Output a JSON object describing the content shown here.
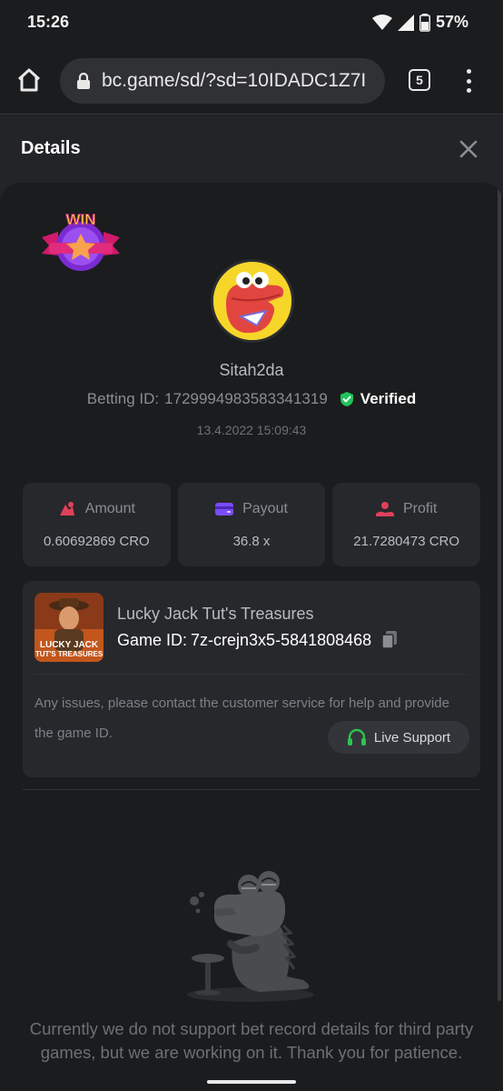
{
  "status": {
    "time": "15:26",
    "battery": "57%"
  },
  "browser": {
    "url": "bc.game/sd/?sd=10IDADC1Z7I",
    "tab_count": "5"
  },
  "details": {
    "title": "Details",
    "win_label": "WIN",
    "username": "Sitah2da",
    "betting_id_label": "Betting ID:",
    "betting_id": "1729994983583341319",
    "verified": "Verified",
    "timestamp": "13.4.2022 15:09:43",
    "stats": [
      {
        "label": "Amount",
        "value": "0.60692869 CRO",
        "color": "#e0405a"
      },
      {
        "label": "Payout",
        "value": "36.8 x",
        "color": "#7b4bff"
      },
      {
        "label": "Profit",
        "value": "21.7280473 CRO",
        "color": "#e0405a"
      }
    ],
    "game": {
      "name": "Lucky Jack Tut's Treasures",
      "id_label": "Game ID:",
      "id": "7z-crejn3x5-5841808468",
      "thumb_text_1": "LUCKY JACK",
      "thumb_text_2": "TUT'S TREASURES"
    },
    "issue_text": "Any issues, please contact the customer service for help and provide the game ID.",
    "live_support": "Live Support",
    "bottom_message": "Currently we do not support bet record details for third party games, but we are working on it. Thank you for patience."
  },
  "colors": {
    "verified_green": "#1fc35b",
    "support_green": "#2ec24e",
    "background": "#1b1c1e"
  },
  "icons": [
    "home-icon",
    "lock-icon",
    "close-icon",
    "verified-icon",
    "amount-icon",
    "payout-icon",
    "profit-icon",
    "copy-icon",
    "headset-icon"
  ]
}
